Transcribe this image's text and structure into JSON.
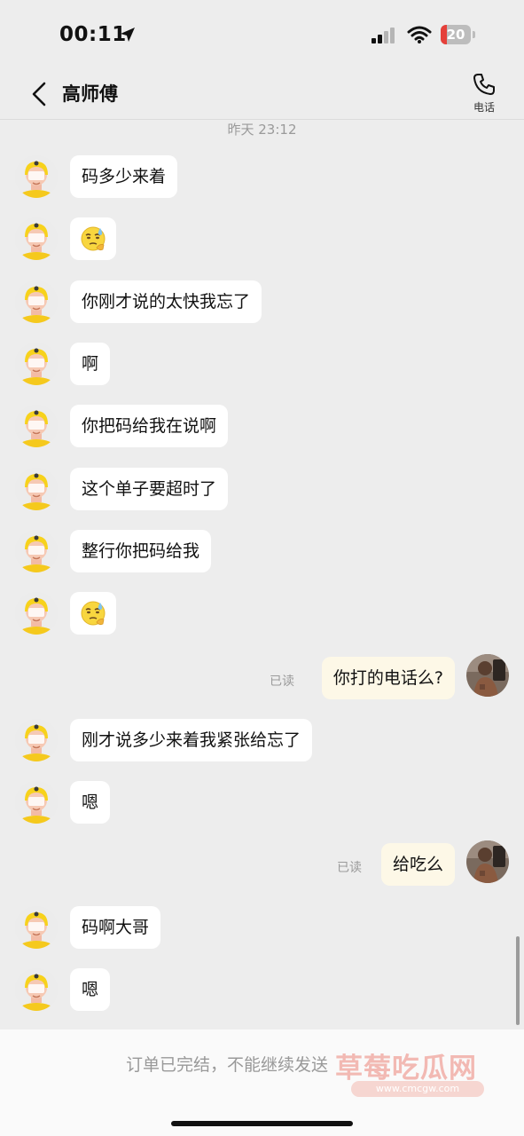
{
  "status": {
    "time": "00:11",
    "battery": "20"
  },
  "header": {
    "title": "高师傅",
    "call_label": "电话"
  },
  "timestamp": "昨天 23:12",
  "messages": [
    {
      "text": "码多少来着"
    },
    {
      "text": ""
    },
    {
      "text": "你刚才说的太快我忘了"
    },
    {
      "text": "啊"
    },
    {
      "text": "你把码给我在说啊"
    },
    {
      "text": "这个单子要超时了"
    },
    {
      "text": "整行你把码给我"
    },
    {
      "text": ""
    },
    {
      "text": "你打的电话么?",
      "read": "已读"
    },
    {
      "text": "刚才说多少来着我紧张给忘了"
    },
    {
      "text": "嗯"
    },
    {
      "text": "给吃么",
      "read": "已读"
    },
    {
      "text": "码啊大哥"
    },
    {
      "text": "嗯"
    }
  ],
  "footer": {
    "notice": "订单已完结，不能继续发送",
    "watermark": "草莓吃瓜网",
    "watermark_url": "www.cmcgw.com"
  },
  "colors": {
    "background": "#ededed",
    "incoming_bubble": "#ffffff",
    "outgoing_bubble": "#fdf8e7",
    "battery_low": "#e5403a"
  },
  "icons": {
    "back": "chevron-left-icon",
    "call": "phone-icon",
    "emoji": "sweat-smile-emoji-icon"
  }
}
